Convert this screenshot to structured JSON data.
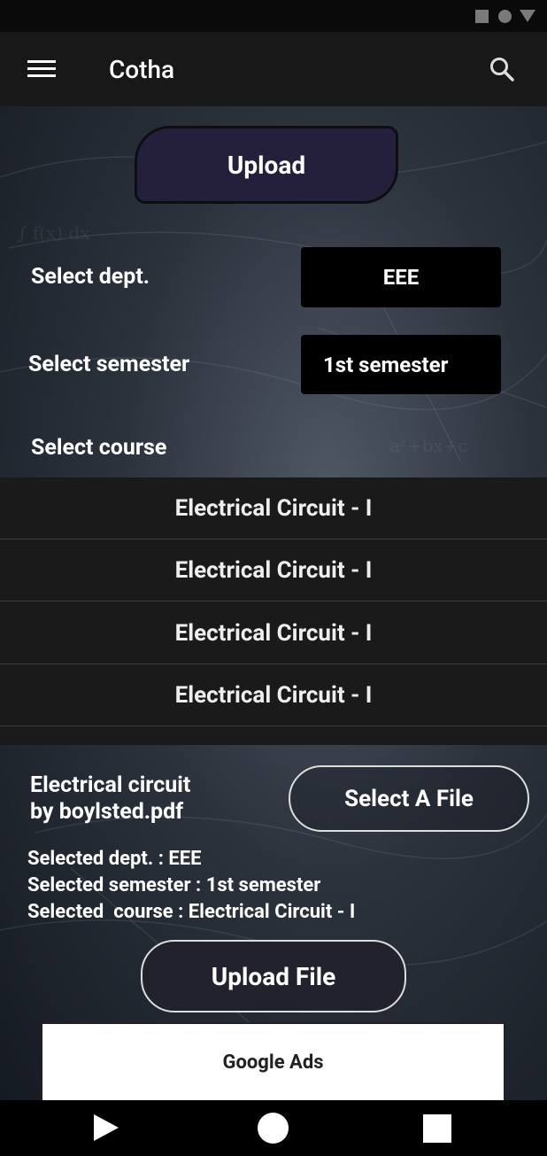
{
  "app": {
    "title": "Cotha"
  },
  "upload_tab": {
    "label": "Upload"
  },
  "dept": {
    "label": "Select dept.",
    "value": "EEE"
  },
  "semester": {
    "label": "Select semester",
    "value": "1st semester"
  },
  "course": {
    "label": "Select course",
    "items": [
      "Electrical Circuit - I",
      "Electrical Circuit - I",
      "Electrical Circuit - I",
      "Electrical Circuit - I"
    ]
  },
  "file": {
    "name": "Electrical circuit\nby boylsted.pdf",
    "select_button": "Select A File"
  },
  "summary": {
    "dept_line": "Selected dept. : EEE",
    "semester_line": "Selected semester : 1st semester",
    "course_line": "Selected  course : Electrical Circuit - I"
  },
  "upload_file_button": "Upload File",
  "ad": {
    "label": "Google Ads"
  },
  "icons": {
    "menu": "hamburger-menu-icon",
    "search": "search-icon",
    "nav_back": "triangle-back-icon",
    "nav_home": "circle-home-icon",
    "nav_recent": "square-recents-icon"
  },
  "colors": {
    "app_bar": "#181818",
    "upload_tab": "#241f3a",
    "select_box": "#000000",
    "list_bg": "#1a1a1a"
  }
}
